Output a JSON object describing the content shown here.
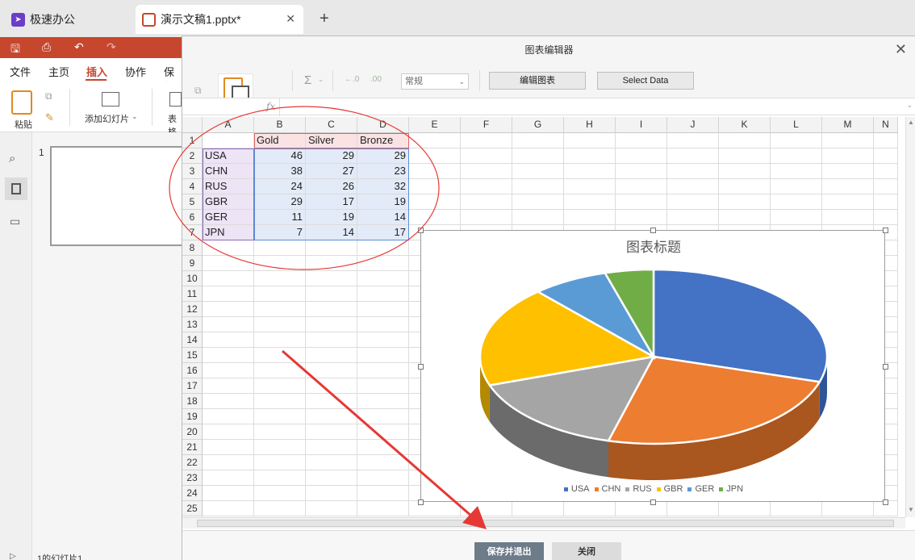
{
  "tabs": {
    "home_label": "极速办公",
    "doc_label": "演示文稿1.pptx*"
  },
  "menu": {
    "items": [
      "文件",
      "主页",
      "插入",
      "协作",
      "保护"
    ]
  },
  "ribbon": {
    "paste_label": "粘贴",
    "add_slide_label": "添加幻灯片",
    "table_label": "表格"
  },
  "thumbs": {
    "slide_number": "1",
    "status_text": "1的幻灯片1"
  },
  "dialog": {
    "title": "图表编辑器",
    "sigma": "Σ",
    "number_format": "常规",
    "edit_chart_label": "编辑图表",
    "select_data_label": "Select Data",
    "fx": "fx",
    "save_label": "保存并退出",
    "close_label": "关闭"
  },
  "sheet": {
    "columns": [
      "A",
      "B",
      "C",
      "D",
      "E",
      "F",
      "G",
      "H",
      "I",
      "J",
      "K",
      "L",
      "M",
      "N"
    ],
    "row_numbers": [
      "1",
      "2",
      "3",
      "4",
      "5",
      "6",
      "7",
      "8",
      "9",
      "10",
      "11",
      "12",
      "13",
      "14",
      "15",
      "16",
      "17",
      "18",
      "19",
      "20",
      "21",
      "22",
      "23",
      "24",
      "25"
    ],
    "header": [
      "",
      "Gold",
      "Silver",
      "Bronze"
    ],
    "rows": [
      [
        "USA",
        "46",
        "29",
        "29"
      ],
      [
        "CHN",
        "38",
        "27",
        "23"
      ],
      [
        "RUS",
        "24",
        "26",
        "32"
      ],
      [
        "GBR",
        "29",
        "17",
        "19"
      ],
      [
        "GER",
        "11",
        "19",
        "14"
      ],
      [
        "JPN",
        "7",
        "14",
        "17"
      ]
    ]
  },
  "chart_data": {
    "type": "pie",
    "title": "图表标题",
    "categories": [
      "USA",
      "CHN",
      "RUS",
      "GBR",
      "GER",
      "JPN"
    ],
    "values": [
      46,
      38,
      24,
      29,
      11,
      7
    ],
    "series_name": "Gold",
    "colors": [
      "#4472c4",
      "#ed7d31",
      "#a5a5a5",
      "#ffc000",
      "#5b9bd5",
      "#70ad47"
    ],
    "dark_colors": [
      "#2f5597",
      "#a9561f",
      "#6b6b6b",
      "#b28900",
      "#3a6f9e",
      "#4a7a2e"
    ],
    "legend_position": "bottom",
    "style": "3d"
  },
  "colors": {
    "accent": "#c6472d",
    "annotation": "#e53935"
  }
}
